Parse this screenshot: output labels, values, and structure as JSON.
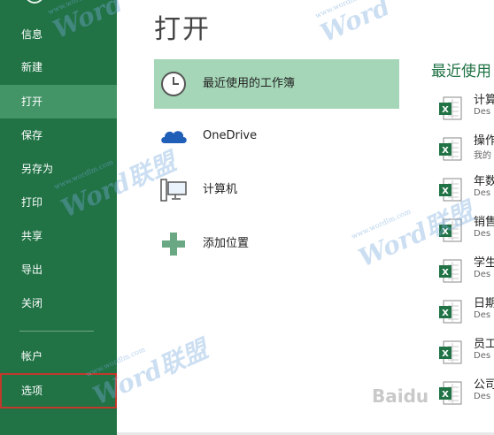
{
  "sidebar": {
    "items": [
      {
        "label": "信息",
        "name": "info"
      },
      {
        "label": "新建",
        "name": "new"
      },
      {
        "label": "打开",
        "name": "open",
        "active": true
      },
      {
        "label": "保存",
        "name": "save"
      },
      {
        "label": "另存为",
        "name": "save-as"
      },
      {
        "label": "打印",
        "name": "print"
      },
      {
        "label": "共享",
        "name": "share"
      },
      {
        "label": "导出",
        "name": "export"
      },
      {
        "label": "关闭",
        "name": "close"
      },
      {
        "label": "帐户",
        "name": "account"
      },
      {
        "label": "选项",
        "name": "options",
        "highlighted": true
      }
    ]
  },
  "main": {
    "title": "打开",
    "places": [
      {
        "label": "最近使用的工作簿",
        "icon": "clock-icon",
        "selected": true
      },
      {
        "label": "OneDrive",
        "icon": "cloud-icon"
      },
      {
        "label": "计算机",
        "icon": "computer-icon"
      },
      {
        "label": "添加位置",
        "icon": "plus-icon"
      }
    ]
  },
  "recent": {
    "title": "最近使用",
    "files": [
      {
        "name": "计算",
        "path": "Des"
      },
      {
        "name": "操作",
        "path": "我的"
      },
      {
        "name": "年数",
        "path": "Des"
      },
      {
        "name": "销售",
        "path": "Des"
      },
      {
        "name": "学生",
        "path": "Des"
      },
      {
        "name": "日期",
        "path": "Des"
      },
      {
        "name": "员工",
        "path": "Des"
      },
      {
        "name": "公司",
        "path": "Des"
      }
    ]
  },
  "watermark": {
    "brand": "Word联盟",
    "brand_en": "Word",
    "brand_cn": "联盟",
    "url": "www.wordlm.com",
    "baidu": "Baidu"
  },
  "colors": {
    "sidebar": "#217346",
    "sidebar_active": "#439467",
    "selected_place": "#a5d6b7",
    "accent": "#217346",
    "options_outline": "#c0392b"
  }
}
